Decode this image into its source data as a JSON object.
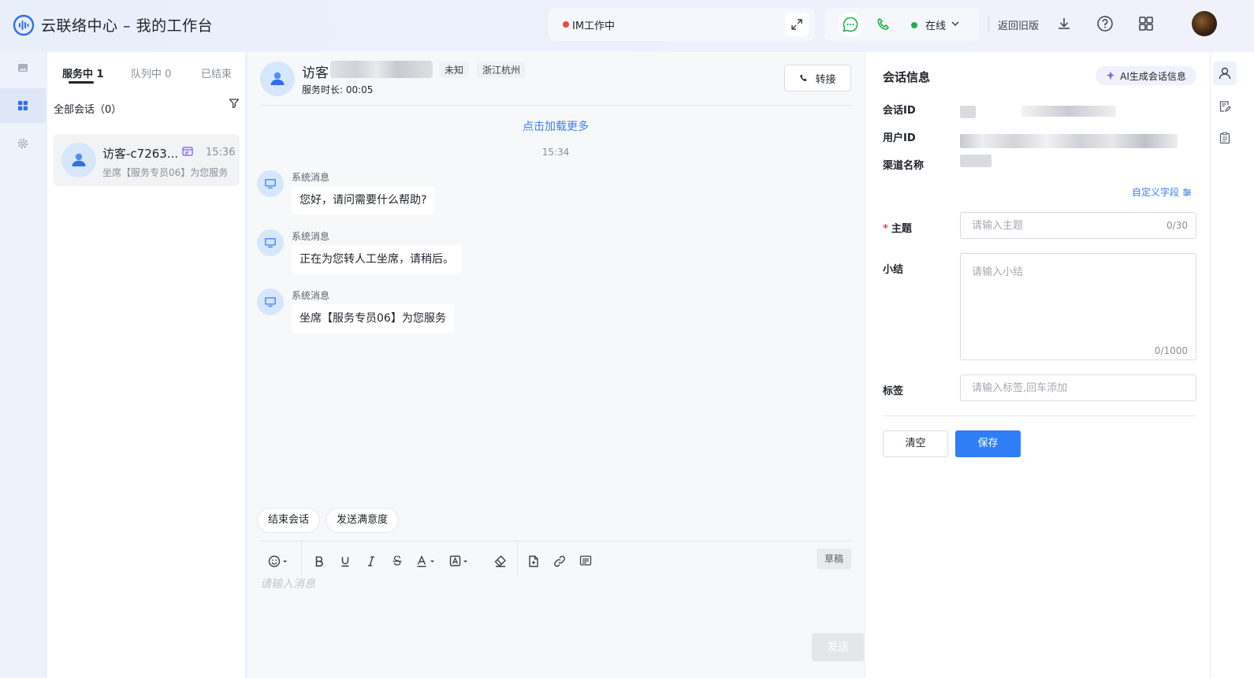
{
  "header": {
    "app_title": "云联络中心 – 我的工作台",
    "im_status": "IM工作中",
    "online_status": "在线",
    "back_to_old": "返回旧版",
    "colors": {
      "im_dot": "#f04848",
      "online_dot": "#22b14c",
      "chat_icon": "#22b14c"
    }
  },
  "left_nav": {
    "items": [
      {
        "icon": "image-icon",
        "active": false
      },
      {
        "icon": "grid-icon",
        "active": true
      },
      {
        "icon": "gear-icon",
        "active": false
      }
    ]
  },
  "session_list": {
    "tabs": [
      {
        "label": "服务中 1",
        "active": true
      },
      {
        "label": "队列中 0",
        "active": false
      },
      {
        "label": "已结束",
        "active": false
      }
    ],
    "all_sessions": "全部会话（0）",
    "sessions": [
      {
        "name": "访客-c7263...",
        "time": "15:36",
        "preview": "坐席【服务专员06】为您服务"
      }
    ]
  },
  "chat": {
    "visitor_name": "访客",
    "chips": [
      "未知",
      "浙江杭州"
    ],
    "service_duration": "服务时长: 00:05",
    "transfer_label": "转接",
    "load_more": "点击加载更多",
    "time_divider": "15:34",
    "messages": [
      {
        "sender": "系统消息",
        "text": "您好，请问需要什么帮助?"
      },
      {
        "sender": "系统消息",
        "text": "正在为您转人工坐席，请稍后。"
      },
      {
        "sender": "系统消息",
        "text": "坐席【服务专员06】为您服务"
      }
    ],
    "actions": [
      "结束会话",
      "发送满意度"
    ],
    "draft_label": "草稿",
    "input_placeholder": "请输入消息",
    "send_label": "发送",
    "accent": "#3a7ff0"
  },
  "session_info": {
    "title": "会话信息",
    "ai_button": "AI生成会话信息",
    "labels": {
      "session_id": "会话ID",
      "user_id": "用户ID",
      "channel_name": "渠道名称"
    },
    "custom_fields": "自定义字段",
    "subject": {
      "label": "主题",
      "placeholder": "请输入主题",
      "counter": "0/30"
    },
    "summary": {
      "label": "小结",
      "placeholder": "请输入小结",
      "counter": "0/1000"
    },
    "tags": {
      "label": "标签",
      "placeholder": "请输入标签,回车添加"
    },
    "clear_label": "清空",
    "save_label": "保存",
    "save_color": "#2f7ef5"
  }
}
